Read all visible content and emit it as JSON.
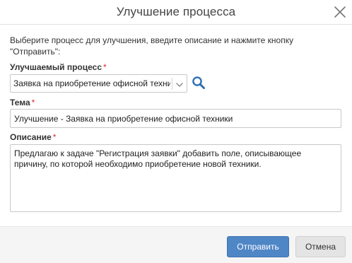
{
  "dialog": {
    "title": "Улучшение процесса",
    "close_icon": "close-icon"
  },
  "form": {
    "instruction": "Выберите процесс для улучшения, введите описание и нажмите кнопку \"Отправить\":",
    "process": {
      "label": "Улучшаемый процесс",
      "required_mark": "*",
      "value": "Заявка на приобретение офисной техники",
      "search_icon": "search-icon"
    },
    "topic": {
      "label": "Тема",
      "required_mark": "*",
      "value": "Улучшение - Заявка на приобретение офисной техники"
    },
    "description": {
      "label": "Описание",
      "required_mark": "*",
      "value": "Предлагаю к задаче \"Регистрация заявки\" добавить поле, описывающее причину, по которой необходимо приобретение новой техники."
    }
  },
  "footer": {
    "submit_label": "Отправить",
    "cancel_label": "Отмена"
  },
  "colors": {
    "primary_button": "#4f86c6",
    "required_mark": "#d9272e",
    "search_icon": "#2f6fb5"
  }
}
